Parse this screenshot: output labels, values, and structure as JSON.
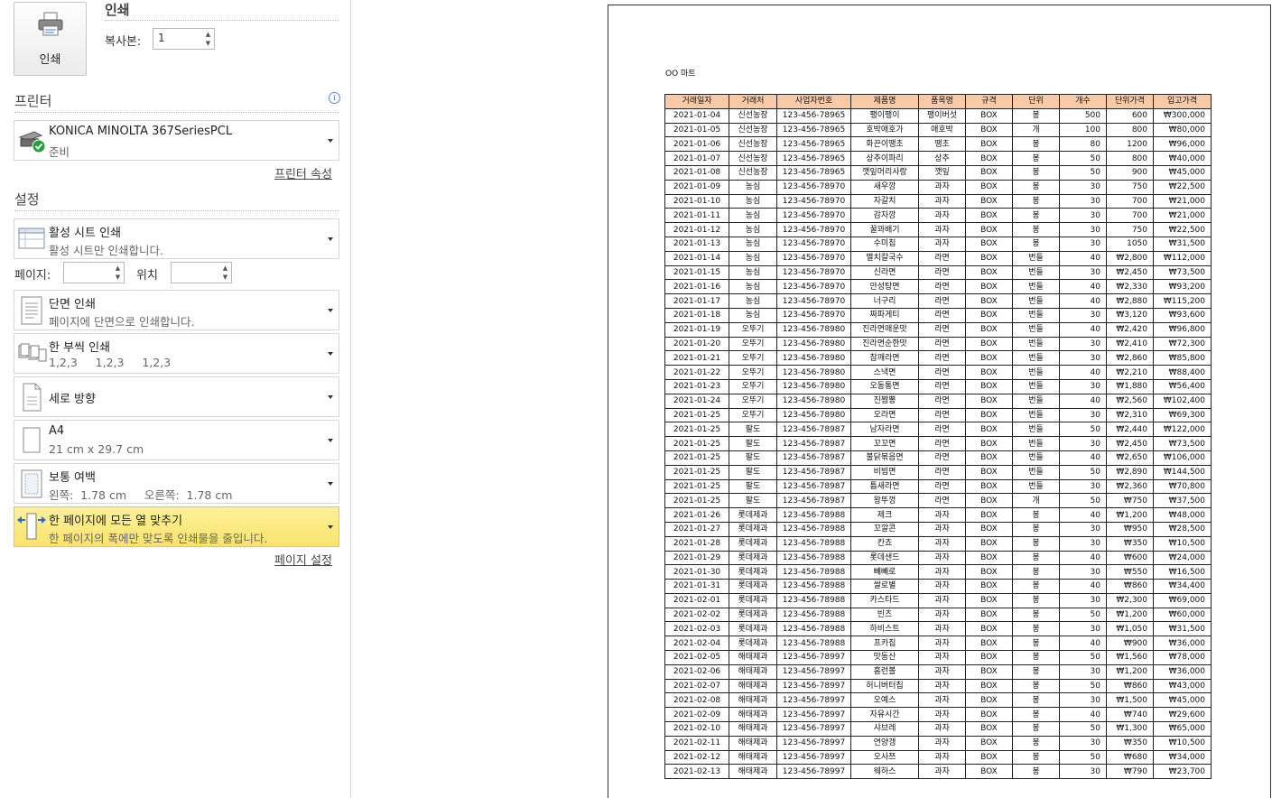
{
  "print": {
    "button_label": "인쇄",
    "title": "인쇄",
    "copies_label": "복사본:",
    "copies_value": "1"
  },
  "printer": {
    "section_title": "프린터",
    "name": "KONICA MINOLTA 367SeriesPCL",
    "status": "준비",
    "properties_link": "프린터 속성"
  },
  "settings": {
    "section_title": "설정",
    "scope": {
      "title": "활성 시트 인쇄",
      "desc": "활성 시트만 인쇄합니다."
    },
    "pages_label": "페이지:",
    "pages_value": "",
    "to_label": "위치",
    "to_value": "",
    "sides": {
      "title": "단면 인쇄",
      "desc": "페이지에 단면으로 인쇄합니다."
    },
    "collate": {
      "title": "한 부씩 인쇄",
      "desc": "1,2,3     1,2,3     1,2,3"
    },
    "orientation": {
      "title": "세로 방향"
    },
    "paper": {
      "title": "A4",
      "desc": "21 cm x 29.7 cm"
    },
    "margins": {
      "title": "보통 여백",
      "desc": "왼쪽:  1.78 cm     오른쪽:  1.78 cm"
    },
    "scaling": {
      "title": "한 페이지에 모든 열 맞추기",
      "desc": "한 페이지의 폭에만 맞도록 인쇄물을 줄입니다."
    },
    "page_setup_link": "페이지 설정"
  },
  "preview": {
    "sheet_title": "OO 마트",
    "columns": [
      "거래일자",
      "거래처",
      "사업자번호",
      "제품명",
      "품목명",
      "규격",
      "단위",
      "개수",
      "단위가격",
      "입고가격"
    ],
    "rows": [
      [
        "2021-01-04",
        "신선농장",
        "123-456-78965",
        "팽이팽이",
        "팽이버섯",
        "BOX",
        "봉",
        "500",
        "600",
        "₩300,000"
      ],
      [
        "2021-01-05",
        "신선농장",
        "123-456-78965",
        "호박애호가",
        "애호박",
        "BOX",
        "개",
        "100",
        "800",
        "₩80,000"
      ],
      [
        "2021-01-06",
        "신선농장",
        "123-456-78965",
        "화끈이땡초",
        "땡초",
        "BOX",
        "봉",
        "80",
        "1200",
        "₩96,000"
      ],
      [
        "2021-01-07",
        "신선농장",
        "123-456-78965",
        "상추이파리",
        "상추",
        "BOX",
        "봉",
        "50",
        "800",
        "₩40,000"
      ],
      [
        "2021-01-08",
        "신선농장",
        "123-456-78965",
        "깻잎머리사랑",
        "깻잎",
        "BOX",
        "봉",
        "50",
        "900",
        "₩45,000"
      ],
      [
        "2021-01-09",
        "농심",
        "123-456-78970",
        "새우깡",
        "과자",
        "BOX",
        "봉",
        "30",
        "750",
        "₩22,500"
      ],
      [
        "2021-01-10",
        "농심",
        "123-456-78970",
        "자갈치",
        "과자",
        "BOX",
        "봉",
        "30",
        "700",
        "₩21,000"
      ],
      [
        "2021-01-11",
        "농심",
        "123-456-78970",
        "감자깡",
        "과자",
        "BOX",
        "봉",
        "30",
        "700",
        "₩21,000"
      ],
      [
        "2021-01-12",
        "농심",
        "123-456-78970",
        "꿀꽈배기",
        "과자",
        "BOX",
        "봉",
        "30",
        "750",
        "₩22,500"
      ],
      [
        "2021-01-13",
        "농심",
        "123-456-78970",
        "수미칩",
        "과자",
        "BOX",
        "봉",
        "30",
        "1050",
        "₩31,500"
      ],
      [
        "2021-01-14",
        "농심",
        "123-456-78970",
        "멸치칼국수",
        "라면",
        "BOX",
        "번들",
        "40",
        "₩2,800",
        "₩112,000"
      ],
      [
        "2021-01-15",
        "농심",
        "123-456-78970",
        "신라면",
        "라면",
        "BOX",
        "번들",
        "30",
        "₩2,450",
        "₩73,500"
      ],
      [
        "2021-01-16",
        "농심",
        "123-456-78970",
        "안성탕면",
        "라면",
        "BOX",
        "번들",
        "40",
        "₩2,330",
        "₩93,200"
      ],
      [
        "2021-01-17",
        "농심",
        "123-456-78970",
        "너구리",
        "라면",
        "BOX",
        "번들",
        "40",
        "₩2,880",
        "₩115,200"
      ],
      [
        "2021-01-18",
        "농심",
        "123-456-78970",
        "짜파게티",
        "라면",
        "BOX",
        "번들",
        "30",
        "₩3,120",
        "₩93,600"
      ],
      [
        "2021-01-19",
        "오뚜기",
        "123-456-78980",
        "진라면매운맛",
        "라면",
        "BOX",
        "번들",
        "40",
        "₩2,420",
        "₩96,800"
      ],
      [
        "2021-01-20",
        "오뚜기",
        "123-456-78980",
        "진라면순한맛",
        "라면",
        "BOX",
        "번들",
        "30",
        "₩2,410",
        "₩72,300"
      ],
      [
        "2021-01-21",
        "오뚜기",
        "123-456-78980",
        "참깨라면",
        "라면",
        "BOX",
        "번들",
        "30",
        "₩2,860",
        "₩85,800"
      ],
      [
        "2021-01-22",
        "오뚜기",
        "123-456-78980",
        "스낵면",
        "라면",
        "BOX",
        "번들",
        "40",
        "₩2,210",
        "₩88,400"
      ],
      [
        "2021-01-23",
        "오뚜기",
        "123-456-78980",
        "오동통면",
        "라면",
        "BOX",
        "번들",
        "30",
        "₩1,880",
        "₩56,400"
      ],
      [
        "2021-01-24",
        "오뚜기",
        "123-456-78980",
        "진짬뽕",
        "라면",
        "BOX",
        "번들",
        "40",
        "₩2,560",
        "₩102,400"
      ],
      [
        "2021-01-25",
        "오뚜기",
        "123-456-78980",
        "오라면",
        "라면",
        "BOX",
        "번들",
        "30",
        "₩2,310",
        "₩69,300"
      ],
      [
        "2021-01-25",
        "팔도",
        "123-456-78987",
        "남자라면",
        "라면",
        "BOX",
        "번들",
        "50",
        "₩2,440",
        "₩122,000"
      ],
      [
        "2021-01-25",
        "팔도",
        "123-456-78987",
        "꼬꼬면",
        "라면",
        "BOX",
        "번들",
        "30",
        "₩2,450",
        "₩73,500"
      ],
      [
        "2021-01-25",
        "팔도",
        "123-456-78987",
        "불닭볶음면",
        "라면",
        "BOX",
        "번들",
        "40",
        "₩2,650",
        "₩106,000"
      ],
      [
        "2021-01-25",
        "팔도",
        "123-456-78987",
        "비빔면",
        "라면",
        "BOX",
        "번들",
        "50",
        "₩2,890",
        "₩144,500"
      ],
      [
        "2021-01-25",
        "팔도",
        "123-456-78987",
        "틈새라면",
        "라면",
        "BOX",
        "번들",
        "30",
        "₩2,360",
        "₩70,800"
      ],
      [
        "2021-01-25",
        "팔도",
        "123-456-78987",
        "왕뚜껑",
        "라면",
        "BOX",
        "개",
        "50",
        "₩750",
        "₩37,500"
      ],
      [
        "2021-01-26",
        "롯데제과",
        "123-456-78988",
        "제크",
        "과자",
        "BOX",
        "봉",
        "40",
        "₩1,200",
        "₩48,000"
      ],
      [
        "2021-01-27",
        "롯데제과",
        "123-456-78988",
        "꼬깔콘",
        "과자",
        "BOX",
        "봉",
        "30",
        "₩950",
        "₩28,500"
      ],
      [
        "2021-01-28",
        "롯데제과",
        "123-456-78988",
        "칸쵸",
        "과자",
        "BOX",
        "봉",
        "30",
        "₩350",
        "₩10,500"
      ],
      [
        "2021-01-29",
        "롯데제과",
        "123-456-78988",
        "롯데샌드",
        "과자",
        "BOX",
        "봉",
        "40",
        "₩600",
        "₩24,000"
      ],
      [
        "2021-01-30",
        "롯데제과",
        "123-456-78988",
        "빼빼로",
        "과자",
        "BOX",
        "봉",
        "30",
        "₩550",
        "₩16,500"
      ],
      [
        "2021-01-31",
        "롯데제과",
        "123-456-78988",
        "쌀로별",
        "과자",
        "BOX",
        "봉",
        "40",
        "₩860",
        "₩34,400"
      ],
      [
        "2021-02-01",
        "롯데제과",
        "123-456-78988",
        "카스타드",
        "과자",
        "BOX",
        "봉",
        "30",
        "₩2,300",
        "₩69,000"
      ],
      [
        "2021-02-02",
        "롯데제과",
        "123-456-78988",
        "빈츠",
        "과자",
        "BOX",
        "봉",
        "50",
        "₩1,200",
        "₩60,000"
      ],
      [
        "2021-02-03",
        "롯데제과",
        "123-456-78988",
        "하비스트",
        "과자",
        "BOX",
        "봉",
        "30",
        "₩1,050",
        "₩31,500"
      ],
      [
        "2021-02-04",
        "롯데제과",
        "123-456-78988",
        "프카칩",
        "과자",
        "BOX",
        "봉",
        "40",
        "₩900",
        "₩36,000"
      ],
      [
        "2021-02-05",
        "해태제과",
        "123-456-78997",
        "맛동산",
        "과자",
        "BOX",
        "봉",
        "50",
        "₩1,560",
        "₩78,000"
      ],
      [
        "2021-02-06",
        "해태제과",
        "123-456-78997",
        "홈런볼",
        "과자",
        "BOX",
        "봉",
        "30",
        "₩1,200",
        "₩36,000"
      ],
      [
        "2021-02-07",
        "해태제과",
        "123-456-78997",
        "허니버터칩",
        "과자",
        "BOX",
        "봉",
        "50",
        "₩860",
        "₩43,000"
      ],
      [
        "2021-02-08",
        "해태제과",
        "123-456-78997",
        "오예스",
        "과자",
        "BOX",
        "봉",
        "30",
        "₩1,500",
        "₩45,000"
      ],
      [
        "2021-02-09",
        "해태제과",
        "123-456-78997",
        "자유시간",
        "과자",
        "BOX",
        "봉",
        "40",
        "₩740",
        "₩29,600"
      ],
      [
        "2021-02-10",
        "해태제과",
        "123-456-78997",
        "샤브레",
        "과자",
        "BOX",
        "봉",
        "50",
        "₩1,300",
        "₩65,000"
      ],
      [
        "2021-02-11",
        "해태제과",
        "123-456-78997",
        "연양갱",
        "과자",
        "BOX",
        "봉",
        "30",
        "₩350",
        "₩10,500"
      ],
      [
        "2021-02-12",
        "해태제과",
        "123-456-78997",
        "오사쯔",
        "과자",
        "BOX",
        "봉",
        "50",
        "₩680",
        "₩34,000"
      ],
      [
        "2021-02-13",
        "해태제과",
        "123-456-78997",
        "웨하스",
        "과자",
        "BOX",
        "봉",
        "30",
        "₩790",
        "₩23,700"
      ]
    ]
  },
  "colors": {
    "header_fill": "#f8caa8",
    "highlight": "#f9e36d"
  }
}
